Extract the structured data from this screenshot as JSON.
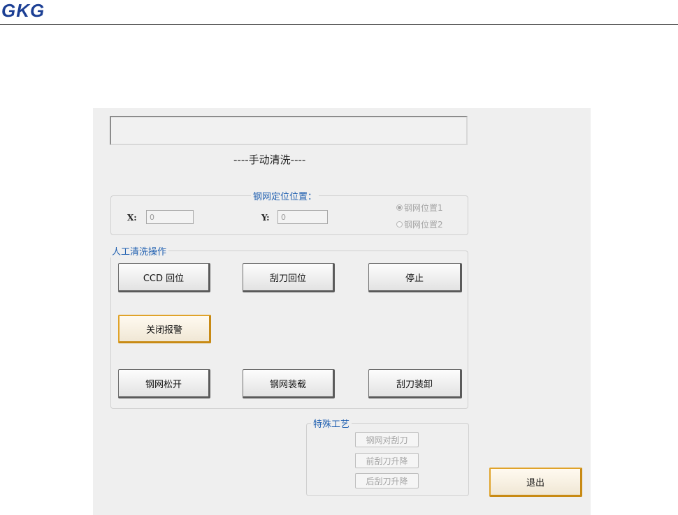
{
  "header": {
    "brand": "GKG"
  },
  "panel": {
    "mode_title": "----手动清洗----",
    "position_group": {
      "legend": "钢网定位位置：",
      "x_label": "X:",
      "x_value": "0",
      "y_label": "Y:",
      "y_value": "0",
      "radio_1": "钢网位置1",
      "radio_2": "钢网位置2"
    },
    "manual_group": {
      "legend": "人工清洗操作",
      "ccd_home": "CCD 回位",
      "squeegee_home": "刮刀回位",
      "stop": "停止",
      "close_alarm": "关闭报警",
      "stencil_release": "钢网松开",
      "stencil_load": "钢网装载",
      "squeegee_mount": "刮刀装卸"
    },
    "special_group": {
      "legend": "特殊工艺",
      "stencil_to_squeegee": "钢网对刮刀",
      "front_squeegee_lift": "前刮刀升降",
      "rear_squeegee_lift": "后刮刀升降"
    },
    "exit": "退出"
  },
  "colors": {
    "brand": "#1c3f94",
    "legend": "#1f5fb0",
    "highlight_border": "#e0a32a",
    "panel_bg": "#efefef"
  }
}
